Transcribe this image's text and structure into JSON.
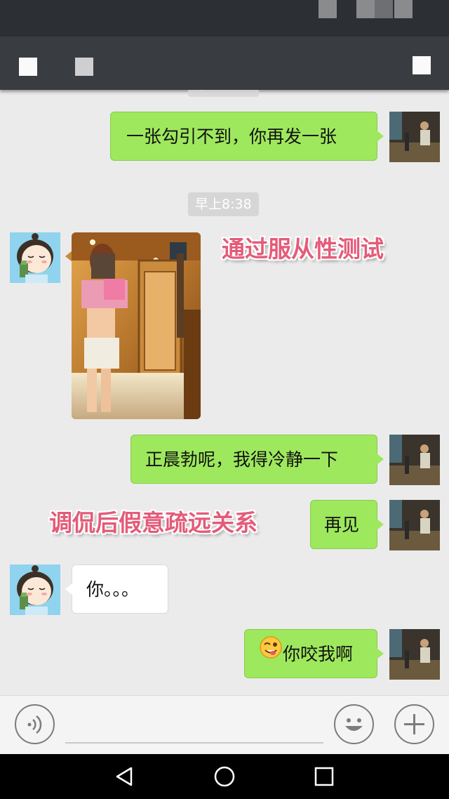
{
  "status_bar": {},
  "nav_bar": {},
  "chat": {
    "time_partial": "早上8:38",
    "time_stamp": "早上8:38",
    "messages": [
      {
        "side": "right",
        "text": "一张勾引不到，你再发一张"
      },
      {
        "side": "left",
        "type": "image"
      },
      {
        "side": "right",
        "text": "正晨勃呢，我得冷静一下"
      },
      {
        "side": "right",
        "text": "再见"
      },
      {
        "side": "left",
        "text": "你。。。"
      },
      {
        "side": "right",
        "emoji": "wink-tongue-emoji",
        "text": "你咬我啊"
      }
    ]
  },
  "overlays": [
    "通过服从性测试",
    "调侃后假意疏远关系"
  ],
  "input_bar": {
    "icons": [
      "voice-icon",
      "emoji-icon",
      "plus-icon"
    ]
  },
  "system_nav": {
    "icons": [
      "back-icon",
      "home-icon",
      "recents-icon"
    ]
  },
  "colors": {
    "bubble_right": "#9ee85d",
    "bubble_left": "#ffffff",
    "chat_background": "#ebebeb",
    "overlay_text": "#e45b79",
    "nav_bar": "#393c40"
  }
}
